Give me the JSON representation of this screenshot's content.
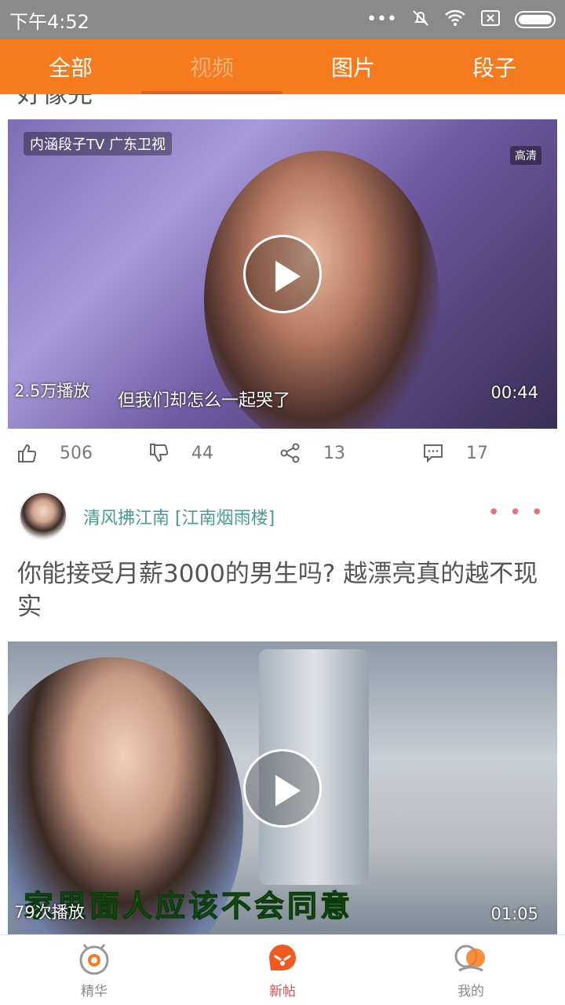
{
  "status_bar": {
    "time": "下午4:52",
    "icons": [
      "more-dots-icon",
      "mute-bell-icon",
      "wifi-icon",
      "no-sim-icon",
      "battery-icon"
    ]
  },
  "tabs": [
    {
      "label": "全部",
      "active": false
    },
    {
      "label": "视频",
      "active": true
    },
    {
      "label": "图片",
      "active": false
    },
    {
      "label": "段子",
      "active": false
    }
  ],
  "feed": {
    "prev_post": {
      "title_fragment": "好像完",
      "video": {
        "watermark_top": "内涵段子TV 广东卫视",
        "hd_badge": "高清",
        "subtitle": "但我们却怎么一起哭了",
        "play_count": "2.5万播放",
        "duration": "00:44"
      },
      "actions": {
        "likes": "506",
        "dislikes": "44",
        "shares": "13",
        "comments": "17"
      }
    },
    "post": {
      "author": "清风拂江南 [江南烟雨楼]",
      "more": "• • •",
      "title": "你能接受月薪3000的男生吗? 越漂亮真的越不现实",
      "video": {
        "subtitle": "家里面人应该不会同意",
        "play_count": "79次播放",
        "duration": "01:05"
      }
    }
  },
  "bottom_nav": [
    {
      "label": "精华",
      "icon": "essence-icon",
      "active": false
    },
    {
      "label": "新帖",
      "icon": "new-posts-icon",
      "active": true
    },
    {
      "label": "我的",
      "icon": "profile-icon",
      "active": false
    }
  ],
  "colors": {
    "tab_bar": "#f67a1e",
    "active_nav": "#ee4a4a",
    "author": "#4a9a96",
    "more_dots": "#f06b7f"
  }
}
